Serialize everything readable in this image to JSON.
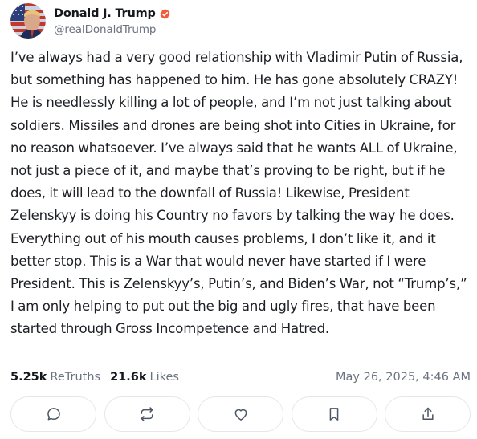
{
  "author": {
    "display_name": "Donald J. Trump",
    "handle": "@realDonaldTrump",
    "verified": true,
    "avatar_icon": "avatar-flag-portrait"
  },
  "post": {
    "text": "I’ve always had a very good relationship with Vladimir Putin of Russia, but something has happened to him. He has gone absolutely CRAZY! He is needlessly killing a lot of people, and I’m not just talking about soldiers. Missiles and drones are being shot into Cities in Ukraine, for no reason whatsoever. I’ve always said that he wants ALL of Ukraine, not just a piece of it, and maybe that’s proving to be right, but if he does, it will lead to the downfall of Russia! Likewise, President Zelenskyy is doing his Country no favors by talking the way he does. Everything out of his mouth causes problems, I don’t like it, and it better stop. This is a War that would never have started if I were President. This is Zelenskyy’s, Putin’s, and Biden’s War, not “Trump’s,” I am only helping to put out the big and ugly fires, that have been started through Gross Incompetence and Hatred."
  },
  "stats": {
    "retruths_count": "5.25k",
    "retruths_label": "ReTruths",
    "likes_count": "21.6k",
    "likes_label": "Likes",
    "timestamp": "May 26, 2025, 4:46 AM"
  },
  "actions": [
    {
      "name": "reply",
      "icon": "comment-icon"
    },
    {
      "name": "retruth",
      "icon": "repost-icon"
    },
    {
      "name": "like",
      "icon": "heart-icon"
    },
    {
      "name": "bookmark",
      "icon": "bookmark-icon"
    },
    {
      "name": "share",
      "icon": "share-icon"
    }
  ],
  "colors": {
    "verified_badge": "#f15a3a",
    "text_primary": "#1c1f24",
    "text_secondary": "#6b7280",
    "button_border": "#e5e7eb",
    "icon_stroke": "#4b5563"
  }
}
